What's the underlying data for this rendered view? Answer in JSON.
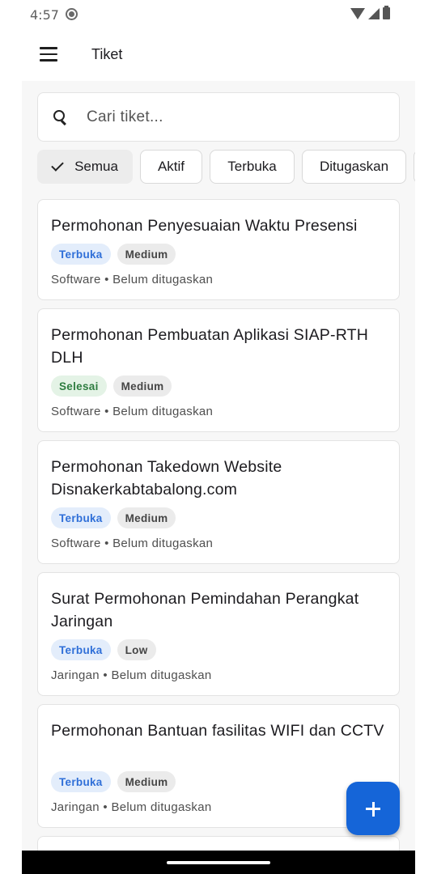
{
  "status_bar": {
    "time": "4:57"
  },
  "app_bar": {
    "title": "Tiket"
  },
  "search": {
    "placeholder": "Cari tiket..."
  },
  "filters": [
    {
      "label": "Semua",
      "selected": true
    },
    {
      "label": "Aktif",
      "selected": false
    },
    {
      "label": "Terbuka",
      "selected": false
    },
    {
      "label": "Ditugaskan",
      "selected": false
    }
  ],
  "tickets": [
    {
      "title": "Permohonan Penyesuaian Waktu Presensi",
      "status": "Terbuka",
      "priority": "Medium",
      "category": "Software",
      "assignment": "Belum ditugaskan"
    },
    {
      "title": "Permohonan Pembuatan Aplikasi SIAP-RTH DLH",
      "status": "Selesai",
      "priority": "Medium",
      "category": "Software",
      "assignment": "Belum ditugaskan"
    },
    {
      "title": "Permohonan Takedown Website Disnakerkabtabalong.com",
      "status": "Terbuka",
      "priority": "Medium",
      "category": "Software",
      "assignment": "Belum ditugaskan"
    },
    {
      "title": "Surat Permohonan Pemindahan Perangkat Jaringan",
      "status": "Terbuka",
      "priority": "Low",
      "category": "Jaringan",
      "assignment": "Belum ditugaskan"
    },
    {
      "title": "Permohonan Bantuan fasilitas WIFI dan CCTV",
      "status": "Terbuka",
      "priority": "Medium",
      "category": "Jaringan",
      "assignment": "Belum ditugaskan"
    }
  ],
  "meta_separator": "•",
  "colors": {
    "accent": "#1565d8",
    "open_badge": "#2f6fd8",
    "done_badge": "#2e7d40"
  },
  "icons": {
    "menu": "menu-icon",
    "search": "search-icon",
    "check": "check-icon",
    "add": "plus-icon"
  }
}
